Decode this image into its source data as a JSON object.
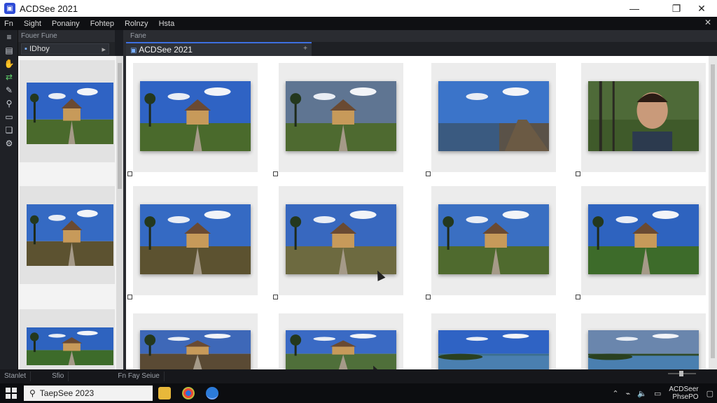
{
  "window": {
    "title": "ACDSee 2021",
    "minimize": "—",
    "maximize": "❐",
    "close": "✕"
  },
  "menu": {
    "items": [
      "Fn",
      "Sight",
      "Ponainy",
      "Fohtep",
      "Rolnzy",
      "Hsta"
    ],
    "close": "✕"
  },
  "toolbar": {
    "items": [
      "≡",
      "▤",
      "✋",
      "⇄",
      "✎",
      "⚲",
      "▭",
      "❏",
      "⚙"
    ]
  },
  "folders_panel": {
    "header": "Fouer Fune",
    "location": "IDhoy",
    "collapse": "▸"
  },
  "content": {
    "header": "Fane",
    "tab": "ACDSee 2021",
    "tab_close": "+"
  },
  "status": {
    "items": [
      "Stanlet",
      "Sfio",
      "Fn Fay Seiue"
    ]
  },
  "taskbar": {
    "search_text": "TaepSee 2023",
    "clock_line1": "ACDSeer",
    "clock_line2": "PhsePO"
  },
  "colors": {
    "accent": "#3d6fe0",
    "sky": "#3a6fc8",
    "grass": "#3f6b2a"
  },
  "thumbnails": [
    {
      "sky": "#2f63c4",
      "ground": "#4a6a2c",
      "subject": "house"
    },
    {
      "sky": "#5f7592",
      "ground": "#4e6a30",
      "subject": "house"
    },
    {
      "sky": "#3b74c9",
      "ground": "#5a5248",
      "subject": "pier"
    },
    {
      "sky": "#4e6a38",
      "ground": "#3f5a2a",
      "subject": "portrait"
    },
    {
      "sky": "#356ac3",
      "ground": "#5c5230",
      "subject": "house"
    },
    {
      "sky": "#3868bf",
      "ground": "#6d6a40",
      "subject": "house"
    },
    {
      "sky": "#3a6fc2",
      "ground": "#4f6a2e",
      "subject": "house"
    },
    {
      "sky": "#2e63bf",
      "ground": "#3d6b2a",
      "subject": "house"
    },
    {
      "sky": "#3e68b8",
      "ground": "#5a4a34",
      "subject": "house"
    },
    {
      "sky": "#3a6ac4",
      "ground": "#4f6f3a",
      "subject": "house"
    },
    {
      "sky": "#2f63c4",
      "ground": "#3b6f8e",
      "subject": "lake"
    },
    {
      "sky": "#6a86ad",
      "ground": "#2f4a2a",
      "subject": "lake"
    }
  ]
}
